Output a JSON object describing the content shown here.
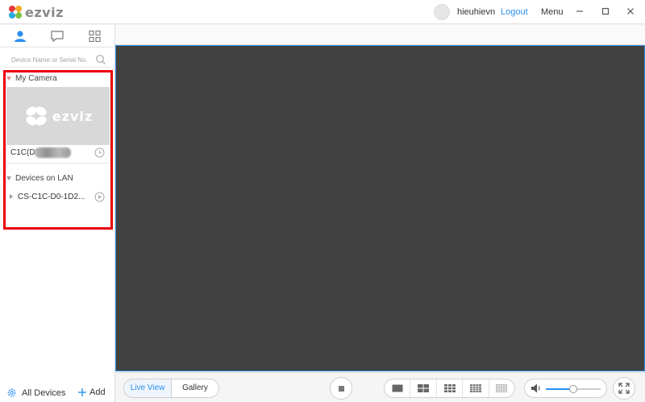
{
  "app": {
    "logo_text": "ezviz"
  },
  "header": {
    "username": "hieuhievn",
    "logout_label": "Logout",
    "menu_label": "Menu"
  },
  "sidebar": {
    "search_placeholder": "Device Name or Serial No.",
    "my_camera_label": "My Camera",
    "camera": {
      "name": "C1C(D2",
      "thumb_logo_text": "ezviz"
    },
    "lan_label": "Devices on LAN",
    "lan_device": "CS-C1C-D0-1D2...",
    "all_devices_label": "All Devices",
    "add_label": "Add"
  },
  "toolbar": {
    "live_view_label": "Live View",
    "gallery_label": "Gallery",
    "volume_level": 0.5
  },
  "colors": {
    "accent": "#2a8ff0",
    "highlight": "#e8000b",
    "video_bg": "#414141"
  }
}
